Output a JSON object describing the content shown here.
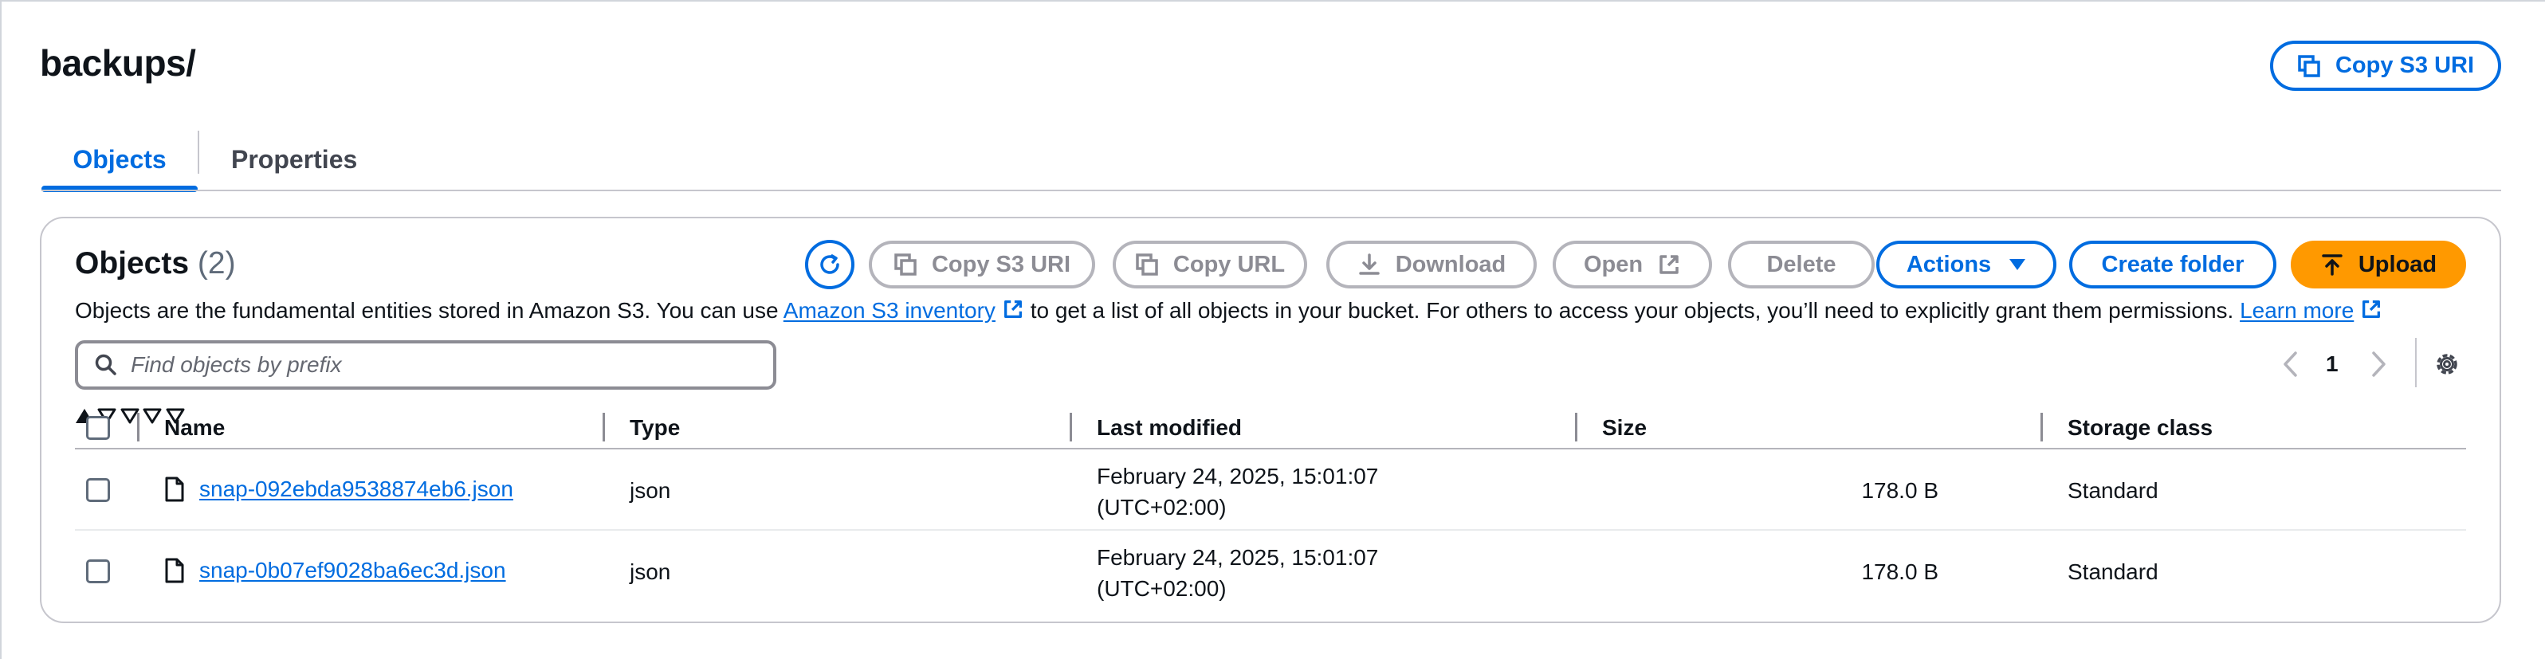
{
  "page": {
    "title": "backups/",
    "copy_s3_uri_label": "Copy S3 URI"
  },
  "tabs": [
    {
      "label": "Objects",
      "active": true
    },
    {
      "label": "Properties",
      "active": false
    }
  ],
  "objects_panel": {
    "title": "Objects",
    "count": "(2)",
    "toolbar": {
      "copy_s3_uri": "Copy S3 URI",
      "copy_url": "Copy URL",
      "download": "Download",
      "open": "Open",
      "delete": "Delete",
      "actions": "Actions",
      "create_folder": "Create folder",
      "upload": "Upload"
    },
    "description": {
      "text_before": "Objects are the fundamental entities stored in Amazon S3. You can use ",
      "inventory_link": "Amazon S3 inventory",
      "text_after": " to get a list of all objects in your bucket. For others to access your objects, you’ll need to explicitly grant them permissions. ",
      "learn_more": "Learn more"
    },
    "search": {
      "placeholder": "Find objects by prefix",
      "value": ""
    },
    "pagination": {
      "current_page": "1"
    },
    "columns": [
      "Name",
      "Type",
      "Last modified",
      "Size",
      "Storage class"
    ],
    "rows": [
      {
        "name": "snap-092ebda9538874eb6.json",
        "type": "json",
        "last_modified_line1": "February 24, 2025, 15:01:07",
        "last_modified_line2": "(UTC+02:00)",
        "size": "178.0 B",
        "storage_class": "Standard"
      },
      {
        "name": "snap-0b07ef9028ba6ec3d.json",
        "type": "json",
        "last_modified_line1": "February 24, 2025, 15:01:07",
        "last_modified_line2": "(UTC+02:00)",
        "size": "178.0 B",
        "storage_class": "Standard"
      }
    ]
  },
  "colors": {
    "accent": "#006ce0",
    "upload": "#ff9900",
    "disabled": "#8c8c94",
    "border": "#c6c6cd"
  },
  "icons": {
    "copy": "copy-icon",
    "refresh": "refresh-icon",
    "download": "download-icon",
    "external": "external-link-icon",
    "caret": "caret-down-icon",
    "upload": "upload-icon",
    "search": "search-icon",
    "file": "file-icon",
    "settings": "gear-icon"
  }
}
